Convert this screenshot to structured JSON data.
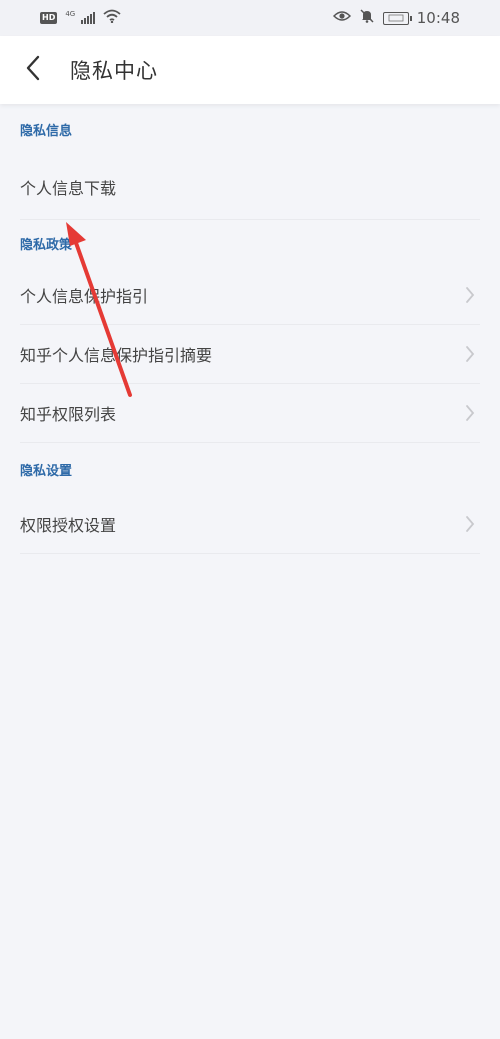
{
  "status_bar": {
    "hd": "HD",
    "network": "4G",
    "time": "10:48",
    "icons": [
      "hd-badge",
      "signal-icon",
      "wifi-icon",
      "eye-icon",
      "bell-muted-icon",
      "battery-icon"
    ]
  },
  "header": {
    "title": "隐私中心",
    "back_icon": "chevron-left-icon"
  },
  "sections": [
    {
      "title": "隐私信息",
      "items": [
        {
          "label": "个人信息下载",
          "chevron": false
        }
      ]
    },
    {
      "title": "隐私政策",
      "items": [
        {
          "label": "个人信息保护指引",
          "chevron": true
        },
        {
          "label": "知乎个人信息保护指引摘要",
          "chevron": true
        },
        {
          "label": "知乎权限列表",
          "chevron": true
        }
      ]
    },
    {
      "title": "隐私设置",
      "items": [
        {
          "label": "权限授权设置",
          "chevron": true
        }
      ]
    }
  ],
  "colors": {
    "accent": "#2e6aa8",
    "annotation_arrow": "#e53a35",
    "background": "#f4f5f9"
  }
}
